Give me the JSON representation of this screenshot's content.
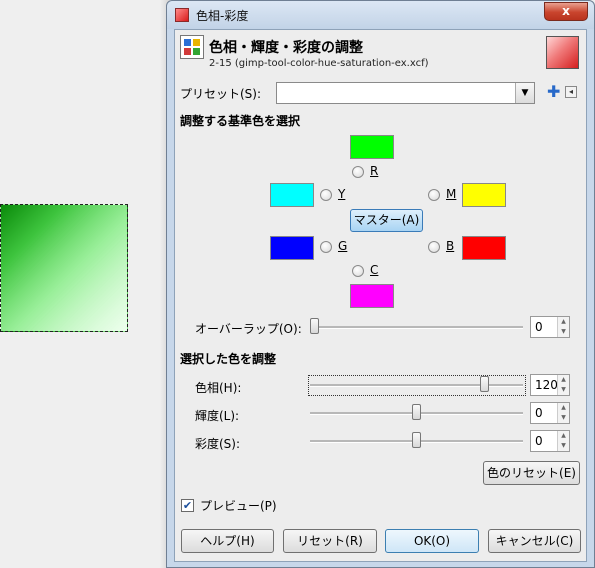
{
  "window": {
    "title": "色相-彩度",
    "close_label": "x"
  },
  "header": {
    "title": "色相・輝度・彩度の調整",
    "subtitle": "2-15 (gimp-tool-color-hue-saturation-ex.xcf)"
  },
  "preset": {
    "label": "プリセット(S):",
    "value": ""
  },
  "primary_section": {
    "title": "調整する基準色を選択",
    "colors": {
      "R": {
        "label": "R",
        "color": "#00ff00"
      },
      "Y": {
        "label": "Y",
        "color": "#00ffff"
      },
      "M": {
        "label": "M",
        "color": "#ffff00"
      },
      "G": {
        "label": "G",
        "color": "#0000ff"
      },
      "B": {
        "label": "B",
        "color": "#ff0000"
      },
      "C": {
        "label": "C",
        "color": "#ff00ff"
      }
    },
    "master_button": "マスター(A)"
  },
  "overlap": {
    "label": "オーバーラップ(O):",
    "value": "0",
    "fraction": 0.0
  },
  "adjust_section": {
    "title": "選択した色を調整",
    "hue": {
      "label": "色相(H):",
      "value": "120",
      "fraction": 0.833
    },
    "lightness": {
      "label": "輝度(L):",
      "value": "0",
      "fraction": 0.5
    },
    "saturation": {
      "label": "彩度(S):",
      "value": "0",
      "fraction": 0.5
    }
  },
  "reset_color_button": "色のリセット(E)",
  "preview": {
    "label": "プレビュー(P)",
    "checked": true
  },
  "buttons": {
    "help": "ヘルプ(H)",
    "reset": "リセット(R)",
    "ok": "OK(O)",
    "cancel": "キャンセル(C)"
  }
}
